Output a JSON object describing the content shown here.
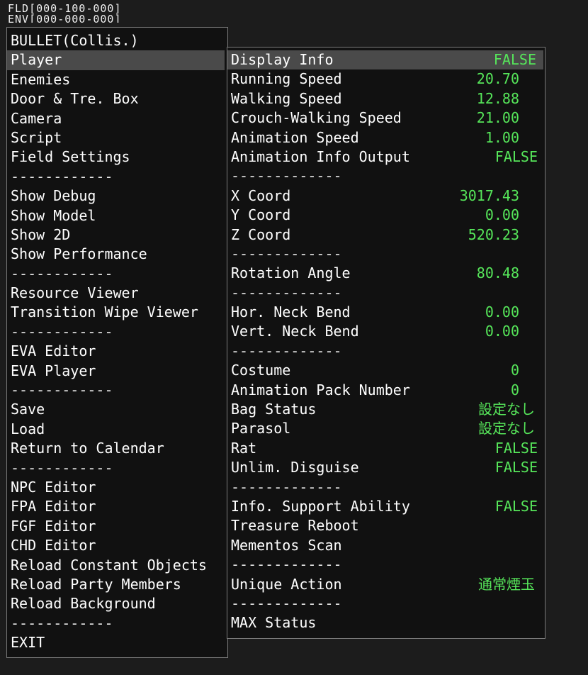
{
  "status": {
    "fld": "FLD[000-100-000]",
    "env": "ENV[000-000-000]"
  },
  "left_menu": [
    {
      "label": "BULLET(Collis.)"
    },
    {
      "label": "Player",
      "selected": true
    },
    {
      "label": "Enemies"
    },
    {
      "label": "Door & Tre. Box"
    },
    {
      "label": "Camera"
    },
    {
      "label": "Script"
    },
    {
      "label": "Field Settings"
    },
    {
      "label": "------------",
      "separator": true
    },
    {
      "label": "Show Debug"
    },
    {
      "label": "Show Model"
    },
    {
      "label": "Show 2D"
    },
    {
      "label": "Show Performance"
    },
    {
      "label": "------------",
      "separator": true
    },
    {
      "label": "Resource Viewer"
    },
    {
      "label": "Transition Wipe Viewer"
    },
    {
      "label": "------------",
      "separator": true
    },
    {
      "label": "EVA Editor"
    },
    {
      "label": "EVA Player"
    },
    {
      "label": "------------",
      "separator": true
    },
    {
      "label": "Save"
    },
    {
      "label": "Load"
    },
    {
      "label": "Return to Calendar"
    },
    {
      "label": "------------",
      "separator": true
    },
    {
      "label": "NPC Editor"
    },
    {
      "label": "FPA Editor"
    },
    {
      "label": "FGF Editor"
    },
    {
      "label": "CHD Editor"
    },
    {
      "label": "Reload Constant Objects"
    },
    {
      "label": "Reload Party Members"
    },
    {
      "label": "Reload Background"
    },
    {
      "label": "------------",
      "separator": true
    },
    {
      "label": "EXIT"
    }
  ],
  "right_menu": [
    {
      "label": "Display Info",
      "value": "FALSE",
      "selected": true,
      "kind": "bool"
    },
    {
      "label": "Running Speed",
      "value": "20.70",
      "kind": "num"
    },
    {
      "label": "Walking Speed",
      "value": "12.88",
      "kind": "num"
    },
    {
      "label": "Crouch-Walking Speed",
      "value": "21.00",
      "kind": "num"
    },
    {
      "label": "Animation Speed",
      "value": "1.00",
      "kind": "num"
    },
    {
      "label": "Animation Info Output",
      "value": "FALSE",
      "kind": "bool"
    },
    {
      "label": "-------------",
      "separator": true
    },
    {
      "label": "X Coord",
      "value": "3017.43",
      "kind": "num"
    },
    {
      "label": "Y Coord",
      "value": "0.00",
      "kind": "num"
    },
    {
      "label": "Z Coord",
      "value": "520.23",
      "kind": "num"
    },
    {
      "label": "-------------",
      "separator": true
    },
    {
      "label": "Rotation Angle",
      "value": "80.48",
      "kind": "num"
    },
    {
      "label": "-------------",
      "separator": true
    },
    {
      "label": "Hor. Neck Bend",
      "value": "0.00",
      "kind": "num"
    },
    {
      "label": "Vert. Neck Bend",
      "value": "0.00",
      "kind": "num"
    },
    {
      "label": "-------------",
      "separator": true
    },
    {
      "label": "Costume",
      "value": "0",
      "kind": "zero"
    },
    {
      "label": "Animation Pack Number",
      "value": "0",
      "kind": "zero"
    },
    {
      "label": "Bag Status",
      "value": "設定なし",
      "kind": "jp"
    },
    {
      "label": "Parasol",
      "value": "設定なし",
      "kind": "jp"
    },
    {
      "label": "Rat",
      "value": "FALSE",
      "kind": "bool"
    },
    {
      "label": "Unlim. Disguise",
      "value": "FALSE",
      "kind": "bool"
    },
    {
      "label": "-------------",
      "separator": true
    },
    {
      "label": "Info. Support Ability",
      "value": "FALSE",
      "kind": "bool"
    },
    {
      "label": "Treasure Reboot"
    },
    {
      "label": "Mementos Scan"
    },
    {
      "label": "-------------",
      "separator": true
    },
    {
      "label": "Unique Action",
      "value": "通常煙玉",
      "kind": "jp"
    },
    {
      "label": "-------------",
      "separator": true
    },
    {
      "label": "MAX Status"
    }
  ],
  "colors": {
    "value_green": "#56e65a",
    "selected_bg": "#4a4a4a",
    "panel_bg": "#111111",
    "page_bg": "#1c1c1c"
  }
}
